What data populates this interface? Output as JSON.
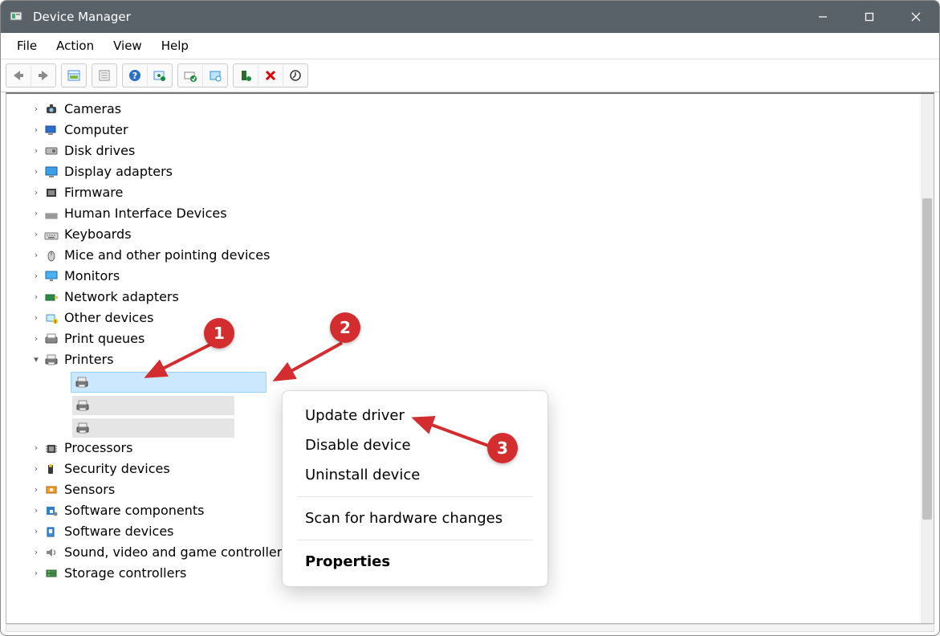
{
  "window": {
    "title": "Device Manager"
  },
  "menu": {
    "items": [
      "File",
      "Action",
      "View",
      "Help"
    ]
  },
  "toolbar": {
    "back": "back-arrow",
    "forward": "forward-arrow",
    "prop": "properties",
    "help": "help",
    "scan": "scan-hardware",
    "update": "update-driver",
    "enable": "enable",
    "uninstall": "uninstall",
    "showhidden": "show-hidden"
  },
  "tree": {
    "items": [
      {
        "label": "Cameras",
        "icon": "camera"
      },
      {
        "label": "Computer",
        "icon": "computer"
      },
      {
        "label": "Disk drives",
        "icon": "disk"
      },
      {
        "label": "Display adapters",
        "icon": "display"
      },
      {
        "label": "Firmware",
        "icon": "firmware"
      },
      {
        "label": "Human Interface Devices",
        "icon": "hid"
      },
      {
        "label": "Keyboards",
        "icon": "keyboard"
      },
      {
        "label": "Mice and other pointing devices",
        "icon": "mouse"
      },
      {
        "label": "Monitors",
        "icon": "monitor"
      },
      {
        "label": "Network adapters",
        "icon": "network"
      },
      {
        "label": "Other devices",
        "icon": "other"
      },
      {
        "label": "Print queues",
        "icon": "printqueue"
      },
      {
        "label": "Printers",
        "icon": "printer",
        "expanded": true,
        "children": [
          {
            "label": "",
            "icon": "printer",
            "selected": true
          },
          {
            "label": "",
            "icon": "printer"
          },
          {
            "label": "",
            "icon": "printer"
          }
        ]
      },
      {
        "label": "Processors",
        "icon": "cpu"
      },
      {
        "label": "Security devices",
        "icon": "security"
      },
      {
        "label": "Sensors",
        "icon": "sensor"
      },
      {
        "label": "Software components",
        "icon": "swcomp"
      },
      {
        "label": "Software devices",
        "icon": "swdev"
      },
      {
        "label": "Sound, video and game controllers",
        "icon": "sound"
      },
      {
        "label": "Storage controllers",
        "icon": "storage"
      }
    ]
  },
  "context_menu": {
    "items": [
      {
        "label": "Update driver"
      },
      {
        "label": "Disable device"
      },
      {
        "label": "Uninstall device"
      },
      {
        "sep": true
      },
      {
        "label": "Scan for hardware changes"
      },
      {
        "sep": true
      },
      {
        "label": "Properties",
        "bold": true
      }
    ]
  },
  "annotations": {
    "c1": "1",
    "c2": "2",
    "c3": "3"
  }
}
